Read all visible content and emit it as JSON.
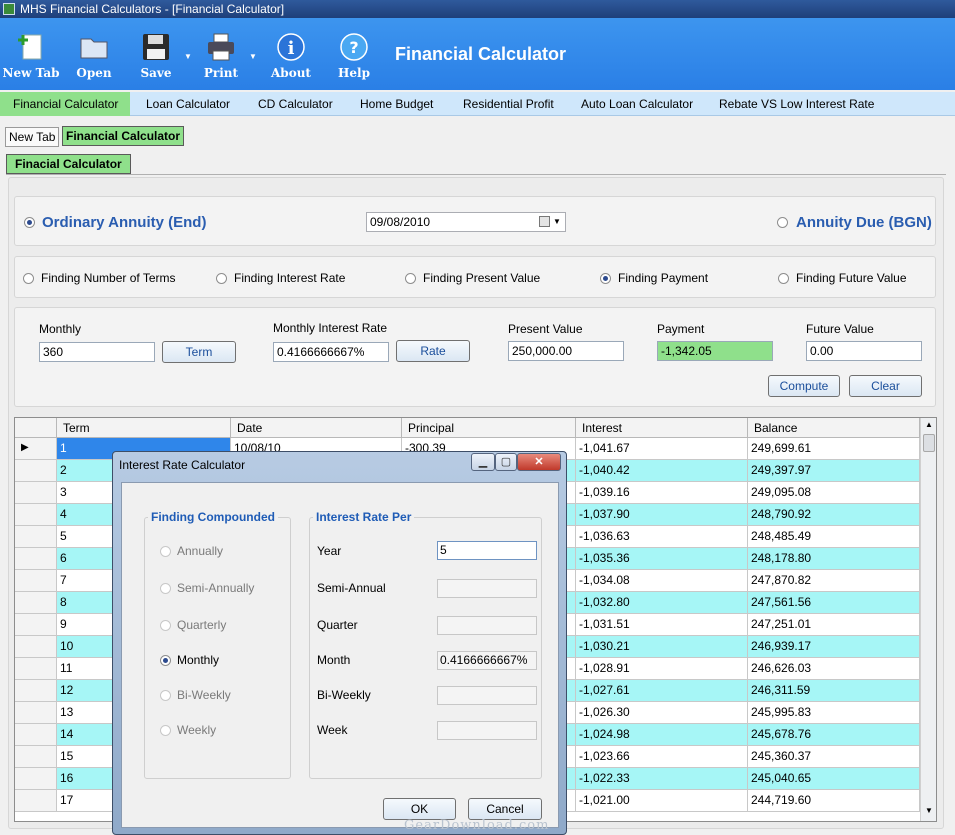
{
  "window": {
    "title": "MHS Financial Calculators - [Financial Calculator]"
  },
  "toolbar": {
    "items": [
      {
        "label": "New Tab",
        "icon": "new-tab-icon"
      },
      {
        "label": "Open",
        "icon": "folder-icon"
      },
      {
        "label": "Save",
        "icon": "floppy-disk-icon"
      },
      {
        "label": "Print",
        "icon": "printer-icon"
      },
      {
        "label": "About",
        "icon": "info-icon"
      },
      {
        "label": "Help",
        "icon": "help-icon"
      }
    ],
    "app_title": "Financial Calculator"
  },
  "menu": {
    "items": [
      "Financial Calculator",
      "Loan Calculator",
      "CD Calculator",
      "Home Budget",
      "Residential Profit",
      "Auto Loan Calculator",
      "Rebate VS Low Interest Rate"
    ],
    "active": "Financial Calculator"
  },
  "tabs": {
    "items": [
      "New Tab",
      "Financial Calculator"
    ],
    "subtab": "Finacial Calculator"
  },
  "annuity": {
    "ordinary": "Ordinary Annuity (End)",
    "date": "09/08/2010",
    "due": "Annuity Due (BGN)"
  },
  "finding": {
    "options": [
      "Finding Number of Terms",
      "Finding Interest Rate",
      "Finding Present Value",
      "Finding Payment",
      "Finding Future Value"
    ],
    "selected": "Finding Payment"
  },
  "inputs": {
    "monthly_label": "Monthly",
    "monthly_value": "360",
    "term_button": "Term",
    "rate_label": "Monthly Interest Rate",
    "rate_value": "0.4166666667%",
    "rate_button": "Rate",
    "pv_label": "Present Value",
    "pv_value": "250,000.00",
    "payment_label": "Payment",
    "payment_value": "-1,342.05",
    "fv_label": "Future Value",
    "fv_value": "0.00",
    "compute": "Compute",
    "clear": "Clear"
  },
  "grid": {
    "columns": [
      "Term",
      "Date",
      "Principal",
      "Interest",
      "Balance"
    ],
    "rows": [
      [
        "1",
        "10/08/10",
        "-300.39",
        "-1,041.67",
        "249,699.61"
      ],
      [
        "2",
        "",
        "",
        "-1,040.42",
        "249,397.97"
      ],
      [
        "3",
        "",
        "",
        "-1,039.16",
        "249,095.08"
      ],
      [
        "4",
        "",
        "",
        "-1,037.90",
        "248,790.92"
      ],
      [
        "5",
        "",
        "",
        "-1,036.63",
        "248,485.49"
      ],
      [
        "6",
        "",
        "",
        "-1,035.36",
        "248,178.80"
      ],
      [
        "7",
        "",
        "",
        "-1,034.08",
        "247,870.82"
      ],
      [
        "8",
        "",
        "",
        "-1,032.80",
        "247,561.56"
      ],
      [
        "9",
        "",
        "",
        "-1,031.51",
        "247,251.01"
      ],
      [
        "10",
        "",
        "",
        "-1,030.21",
        "246,939.17"
      ],
      [
        "11",
        "",
        "",
        "-1,028.91",
        "246,626.03"
      ],
      [
        "12",
        "",
        "",
        "-1,027.61",
        "246,311.59"
      ],
      [
        "13",
        "",
        "",
        "-1,026.30",
        "245,995.83"
      ],
      [
        "14",
        "",
        "",
        "-1,024.98",
        "245,678.76"
      ],
      [
        "15",
        "",
        "",
        "-1,023.66",
        "245,360.37"
      ],
      [
        "16",
        "",
        "",
        "-1,022.33",
        "245,040.65"
      ],
      [
        "17",
        "",
        "",
        "-1,021.00",
        "244,719.60"
      ]
    ]
  },
  "dialog": {
    "title": "Interest Rate Calculator",
    "compounded_title": "Finding Compounded",
    "compounded_options": [
      "Annually",
      "Semi-Annually",
      "Quarterly",
      "Monthly",
      "Bi-Weekly",
      "Weekly"
    ],
    "compounded_selected": "Monthly",
    "rate_per_title": "Interest Rate Per",
    "rate_rows": [
      {
        "label": "Year",
        "value": "5"
      },
      {
        "label": "Semi-Annual",
        "value": ""
      },
      {
        "label": "Quarter",
        "value": ""
      },
      {
        "label": "Month",
        "value": "0.4166666667%"
      },
      {
        "label": "Bi-Weekly",
        "value": ""
      },
      {
        "label": "Week",
        "value": ""
      }
    ],
    "ok": "OK",
    "cancel": "Cancel"
  },
  "watermark": "GearDownload.com",
  "colors": {
    "ribbon": "#2f86ea",
    "menu_bg": "#cfe7fb",
    "active_green": "#8fe08b",
    "row_alt": "#a6f6f6",
    "heading_blue": "#2a5db0"
  }
}
